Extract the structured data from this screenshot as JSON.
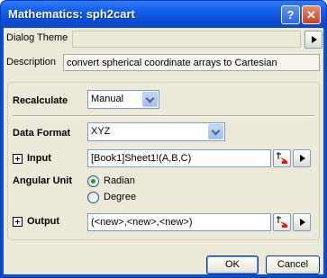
{
  "window": {
    "title": "Mathematics: sph2cart",
    "help_glyph": "?",
    "close_glyph": "✕"
  },
  "theme": {
    "label": "Dialog Theme",
    "value": ""
  },
  "description": {
    "label": "Description",
    "value": "convert spherical coordinate arrays to Cartesian"
  },
  "recalculate": {
    "label": "Recalculate",
    "value": "Manual"
  },
  "data_format": {
    "label": "Data Format",
    "value": "XYZ"
  },
  "input": {
    "label": "Input",
    "value": "[Book1]Sheet1!(A,B,C)"
  },
  "angular_unit": {
    "label": "Angular Unit",
    "options": [
      "Radian",
      "Degree"
    ],
    "selected": "Radian"
  },
  "output": {
    "label": "Output",
    "value": "(<new>,<new>,<new>)"
  },
  "buttons": {
    "ok": "OK",
    "cancel": "Cancel"
  },
  "colors": {
    "title_bar": "#0a4fd6",
    "dialog_bg": "#ece9d8",
    "close_button": "#c9431f",
    "radio_dot": "#21a121"
  }
}
